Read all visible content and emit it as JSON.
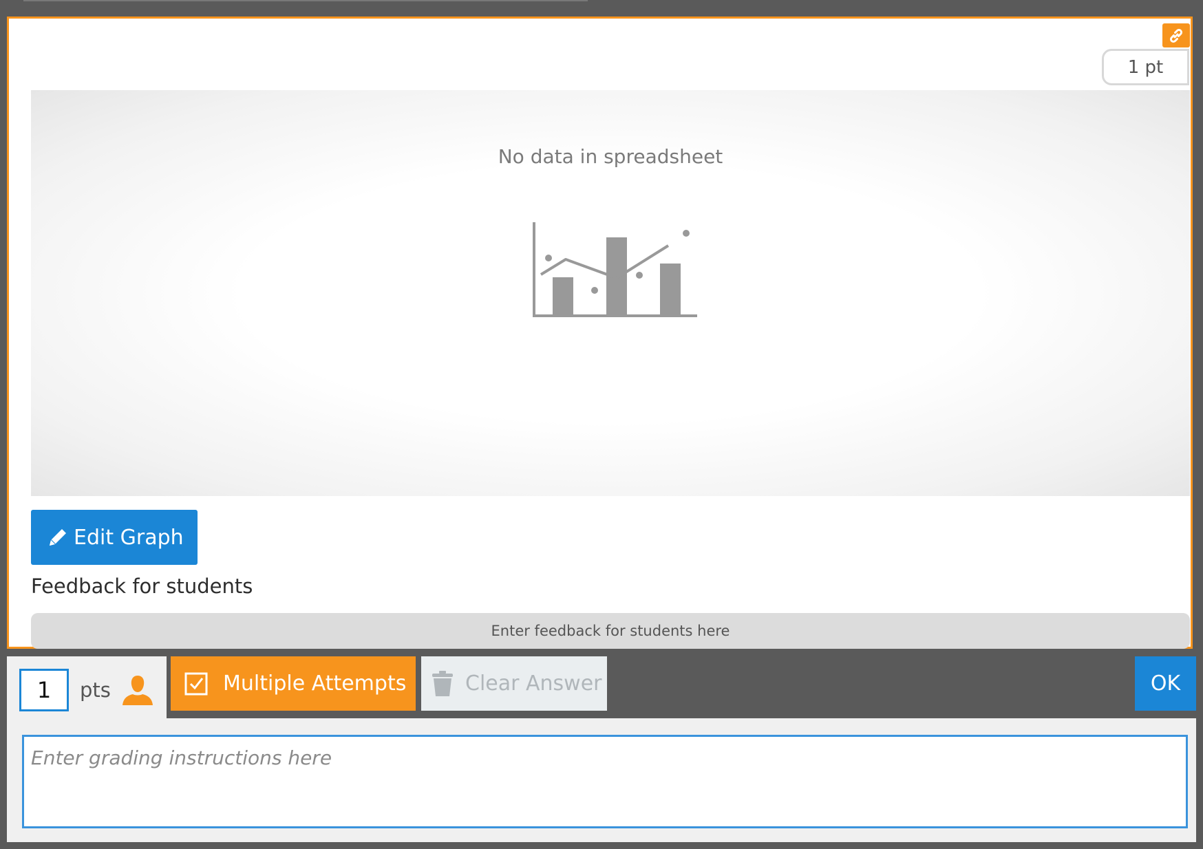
{
  "question": {
    "points_badge": "1 pt",
    "link_icon": "link-icon",
    "chart": {
      "empty_message": "No data in spreadsheet",
      "placeholder_icon": "chart-placeholder-icon"
    },
    "edit_graph": {
      "label": "Edit Graph",
      "icon": "pencil-icon"
    },
    "feedback": {
      "heading": "Feedback for students",
      "placeholder": "Enter feedback for students here"
    }
  },
  "toolbar": {
    "points_value": "1",
    "points_label": "pts",
    "person_icon": "person-icon",
    "multiple_attempts": {
      "label": "Multiple Attempts",
      "checked": true,
      "icon": "checkbox-checked-icon"
    },
    "clear_answer": {
      "label": "Clear Answer",
      "icon": "trash-icon",
      "disabled": true
    },
    "ok_label": "OK"
  },
  "grading": {
    "placeholder": "Enter grading instructions here"
  },
  "colors": {
    "accent_orange": "#f7941d",
    "accent_blue": "#1b86d6",
    "toolbar_bg": "#5a5a5a"
  }
}
